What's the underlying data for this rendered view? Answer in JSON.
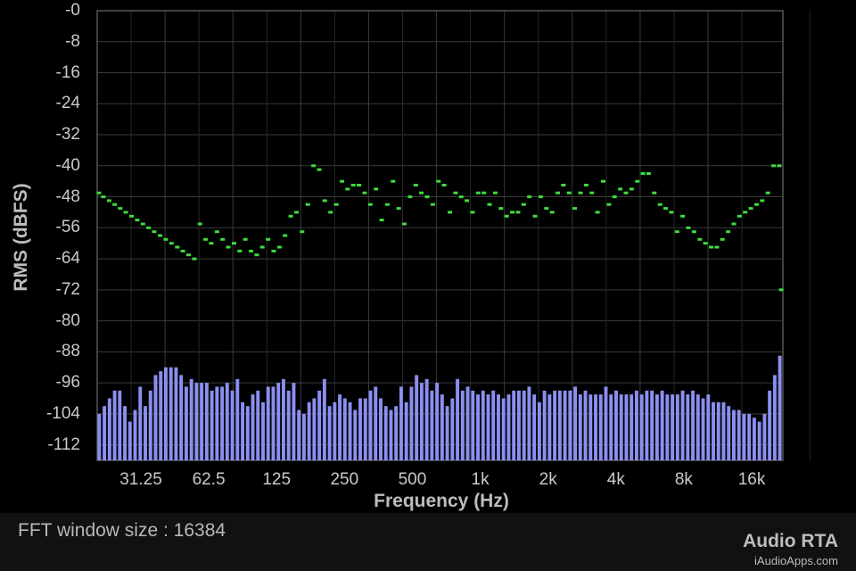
{
  "app": {
    "title": "Audio RTA",
    "site": "iAudioApps.com"
  },
  "footer": {
    "fft_window": "FFT window size : 16384"
  },
  "colors": {
    "background": "#000000",
    "grid": "#3a3a3a",
    "bars": "#8b8ff0",
    "peaks": "#3fdc3f",
    "text": "#c9c9c9"
  },
  "chart_data": {
    "type": "bar",
    "xlabel": "Frequency (Hz)",
    "ylabel": "RMS (dBFS)",
    "ylim": [
      -116,
      0
    ],
    "y_ticks": [
      "-0",
      "-8",
      "-16",
      "-24",
      "-32",
      "-40",
      "-48",
      "-56",
      "-64",
      "-72",
      "-80",
      "-88",
      "-96",
      "-104",
      "-112"
    ],
    "x_ticks": [
      "31.25",
      "62.5",
      "125",
      "250",
      "500",
      "1k",
      "2k",
      "4k",
      "8k",
      "16k"
    ],
    "x_scale": "log2",
    "grid": true,
    "series": [
      {
        "type": "bar",
        "values": [
          -104,
          -102,
          -100,
          -98,
          -98,
          -102,
          -106,
          -103,
          -97,
          -102,
          -98,
          -94,
          -93,
          -92,
          -92,
          -92,
          -94,
          -97,
          -95,
          -96,
          -96,
          -96,
          -98,
          -97,
          -97,
          -96,
          -98,
          -95,
          -101,
          -102,
          -99,
          -98,
          -101,
          -97,
          -97,
          -96,
          -95,
          -98,
          -96,
          -103,
          -104,
          -101,
          -100,
          -98,
          -95,
          -102,
          -101,
          -99,
          -100,
          -101,
          -103,
          -100,
          -100,
          -98,
          -97,
          -100,
          -102,
          -103,
          -102,
          -97,
          -101,
          -97,
          -94,
          -96,
          -95,
          -98,
          -96,
          -99,
          -102,
          -100,
          -95,
          -98,
          -97,
          -98,
          -99,
          -98,
          -99,
          -98,
          -99,
          -100,
          -99,
          -98,
          -98,
          -98,
          -97,
          -99,
          -101,
          -98,
          -99,
          -98,
          -98,
          -98,
          -98,
          -97,
          -99,
          -98,
          -99,
          -99,
          -99,
          -97,
          -99,
          -98,
          -99,
          -99,
          -99,
          -98,
          -99,
          -98,
          -98,
          -99,
          -98,
          -99,
          -99,
          -99,
          -98,
          -99,
          -98,
          -99,
          -100,
          -99,
          -101,
          -101,
          -101,
          -102,
          -103,
          -103,
          -104,
          -104,
          -105,
          -106,
          -104,
          -98,
          -94,
          -89
        ]
      },
      {
        "type": "peaks",
        "points": [
          [
            20,
            -47
          ],
          [
            21.3,
            -48
          ],
          [
            22.6,
            -49
          ],
          [
            23.9,
            -50
          ],
          [
            25.3,
            -51
          ],
          [
            26.8,
            -52
          ],
          [
            28.4,
            -53
          ],
          [
            30.1,
            -54
          ],
          [
            31.9,
            -55
          ],
          [
            33.8,
            -56
          ],
          [
            35.8,
            -57
          ],
          [
            38,
            -58
          ],
          [
            40.3,
            -59
          ],
          [
            42.7,
            -60
          ],
          [
            45.3,
            -61
          ],
          [
            48,
            -62
          ],
          [
            50.8,
            -63
          ],
          [
            53.9,
            -64
          ],
          [
            57.1,
            -55
          ],
          [
            60.5,
            -59
          ],
          [
            64.1,
            -60
          ],
          [
            68,
            -57
          ],
          [
            72,
            -59
          ],
          [
            76.3,
            -61
          ],
          [
            80.9,
            -60
          ],
          [
            85.7,
            -62
          ],
          [
            90.8,
            -59
          ],
          [
            96.2,
            -62
          ],
          [
            102,
            -63
          ],
          [
            108,
            -61
          ],
          [
            114.5,
            -59
          ],
          [
            121.3,
            -62
          ],
          [
            128.6,
            -61
          ],
          [
            136.3,
            -58
          ],
          [
            144.4,
            -53
          ],
          [
            153.1,
            -52
          ],
          [
            162.2,
            -57
          ],
          [
            171.9,
            -50
          ],
          [
            182.2,
            -40
          ],
          [
            193.1,
            -41
          ],
          [
            204.6,
            -49
          ],
          [
            216.8,
            -52
          ],
          [
            229.8,
            -50
          ],
          [
            243.5,
            -44
          ],
          [
            258.1,
            -46
          ],
          [
            273.5,
            -45
          ],
          [
            289.8,
            -45
          ],
          [
            307.1,
            -47
          ],
          [
            325.5,
            -50
          ],
          [
            344.9,
            -46
          ],
          [
            365.5,
            -54
          ],
          [
            387.3,
            -50
          ],
          [
            410.5,
            -44
          ],
          [
            435,
            -51
          ],
          [
            461,
            -55
          ],
          [
            488.5,
            -48
          ],
          [
            517.7,
            -45
          ],
          [
            548.6,
            -47
          ],
          [
            581.4,
            -48
          ],
          [
            616.1,
            -50
          ],
          [
            652.9,
            -44
          ],
          [
            691.9,
            -45
          ],
          [
            733.2,
            -52
          ],
          [
            777,
            -47
          ],
          [
            823.4,
            -48
          ],
          [
            872.6,
            -49
          ],
          [
            924.7,
            -52
          ],
          [
            979.9,
            -47
          ],
          [
            1038,
            -47
          ],
          [
            1100,
            -50
          ],
          [
            1166,
            -47
          ],
          [
            1236,
            -51
          ],
          [
            1310,
            -53
          ],
          [
            1388,
            -52
          ],
          [
            1471,
            -52
          ],
          [
            1559,
            -50
          ],
          [
            1652,
            -48
          ],
          [
            1750,
            -53
          ],
          [
            1855,
            -48
          ],
          [
            1966,
            -51
          ],
          [
            2083,
            -52
          ],
          [
            2207,
            -47
          ],
          [
            2339,
            -45
          ],
          [
            2479,
            -47
          ],
          [
            2627,
            -51
          ],
          [
            2784,
            -47
          ],
          [
            2950,
            -45
          ],
          [
            3126,
            -47
          ],
          [
            3313,
            -52
          ],
          [
            3511,
            -44
          ],
          [
            3721,
            -50
          ],
          [
            3943,
            -48
          ],
          [
            4178,
            -46
          ],
          [
            4428,
            -47
          ],
          [
            4692,
            -46
          ],
          [
            4972,
            -44
          ],
          [
            5269,
            -42
          ],
          [
            5584,
            -42
          ],
          [
            5917,
            -47
          ],
          [
            6271,
            -50
          ],
          [
            6645,
            -51
          ],
          [
            7042,
            -52
          ],
          [
            7463,
            -57
          ],
          [
            7908,
            -53
          ],
          [
            8380,
            -56
          ],
          [
            8881,
            -57
          ],
          [
            9411,
            -59
          ],
          [
            9973,
            -60
          ],
          [
            10570,
            -61
          ],
          [
            11200,
            -61
          ],
          [
            11870,
            -59
          ],
          [
            12580,
            -57
          ],
          [
            13330,
            -55
          ],
          [
            14120,
            -53
          ],
          [
            14970,
            -52
          ],
          [
            15860,
            -51
          ],
          [
            16810,
            -50
          ],
          [
            17810,
            -49
          ],
          [
            18880,
            -47
          ],
          [
            20000,
            -40
          ],
          [
            21190,
            -40
          ],
          [
            22000,
            -72
          ]
        ]
      }
    ]
  }
}
